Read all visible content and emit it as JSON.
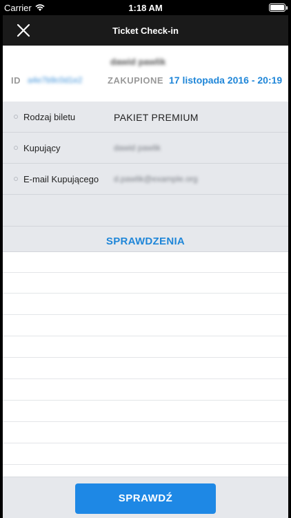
{
  "status_bar": {
    "carrier": "Carrier",
    "time": "1:18 AM",
    "wifi_icon": "wifi-icon",
    "battery_icon": "battery-icon"
  },
  "nav": {
    "title": "Ticket Check-in",
    "close_icon": "close-icon"
  },
  "ticket": {
    "holder_name": "dawid pawlik",
    "id_label": "ID",
    "id_value": "a4e7b9c0d1e2",
    "purchased_label": "ZAKUPIONE",
    "purchased_date": "17 listopada 2016 - 20:19"
  },
  "details": [
    {
      "label": "Rodzaj biletu",
      "value": "PAKIET PREMIUM"
    },
    {
      "label": "Kupujący",
      "value": "dawid pawlik"
    },
    {
      "label": "E-mail Kupującego",
      "value": "d.pawlik@example.org"
    }
  ],
  "checks": {
    "section_title": "SPRAWDZENIA",
    "rows": []
  },
  "actions": {
    "check_button": "SPRAWDŹ"
  },
  "colors": {
    "accent": "#1f86d8",
    "button": "#1e88e5",
    "panel": "#e6e8ec",
    "nav": "#1a1a1a"
  }
}
